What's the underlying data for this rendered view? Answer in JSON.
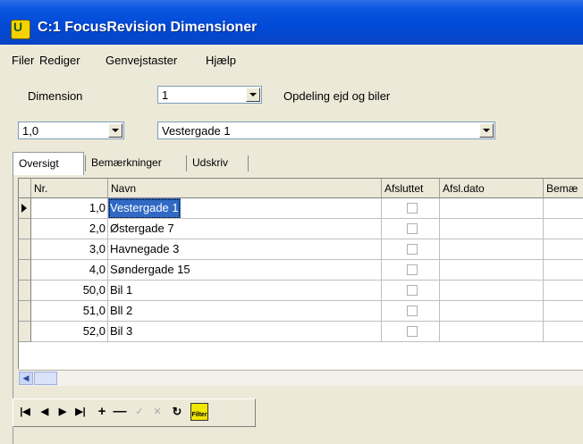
{
  "window": {
    "title": "C:1 FocusRevision Dimensioner",
    "icon": "focus-app-icon",
    "icon_glyph": "U"
  },
  "menu": [
    {
      "label": "Filer"
    },
    {
      "label": "Rediger"
    },
    {
      "label": "Genvejstaster"
    },
    {
      "label": "Hjælp"
    }
  ],
  "filters": {
    "dimension_label": "Dimension",
    "dimension_value": "1",
    "dimension_description": "Opdeling ejd og biler",
    "number_value": "1,0",
    "name_value": "Vestergade 1"
  },
  "tabs": [
    {
      "label": "Oversigt",
      "active": true
    },
    {
      "label": "Bemærkninger",
      "active": false
    },
    {
      "label": "Udskriv",
      "active": false
    }
  ],
  "grid": {
    "columns": [
      "Nr.",
      "Navn",
      "Afsluttet",
      "Afsl.dato",
      "Bemæ"
    ],
    "rows": [
      {
        "nr": "1,0",
        "navn": "Vestergade 1",
        "afsluttet": false,
        "afsl_dato": "",
        "current": true
      },
      {
        "nr": "2,0",
        "navn": "Østergade 7",
        "afsluttet": false,
        "afsl_dato": ""
      },
      {
        "nr": "3,0",
        "navn": "Havnegade 3",
        "afsluttet": false,
        "afsl_dato": ""
      },
      {
        "nr": "4,0",
        "navn": "Søndergade 15",
        "afsluttet": false,
        "afsl_dato": ""
      },
      {
        "nr": "50,0",
        "navn": "Bil 1",
        "afsluttet": false,
        "afsl_dato": ""
      },
      {
        "nr": "51,0",
        "navn": "Bll 2",
        "afsluttet": false,
        "afsl_dato": ""
      },
      {
        "nr": "52,0",
        "navn": "Bil 3",
        "afsluttet": false,
        "afsl_dato": ""
      }
    ]
  },
  "navigator": {
    "buttons": [
      "first-record-icon",
      "prior-record-icon",
      "next-record-icon",
      "last-record-icon",
      "insert-record-icon",
      "delete-record-icon",
      "post-edit-icon",
      "cancel-edit-icon",
      "refresh-icon",
      "filter-icon"
    ],
    "filter_label": "Filter"
  },
  "colors": {
    "titlebar": "#0a55e0",
    "selection": "#316ac5",
    "face": "#ece9d8"
  }
}
